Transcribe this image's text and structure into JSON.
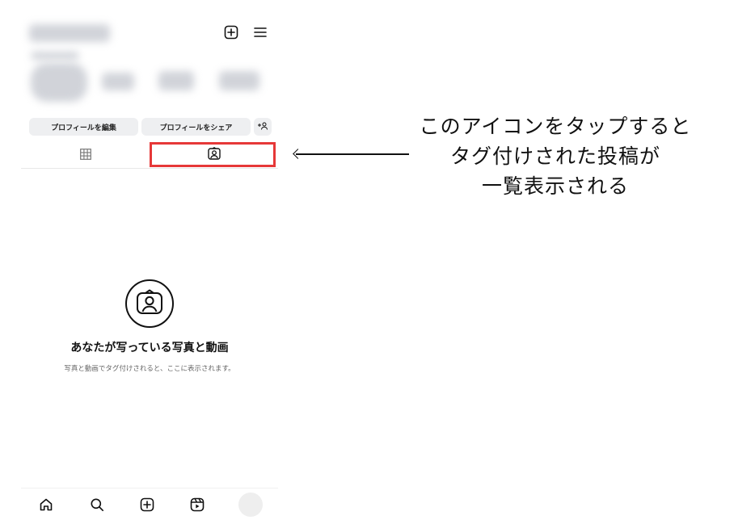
{
  "profile": {
    "edit_button": "プロフィールを編集",
    "share_button": "プロフィールをシェア"
  },
  "header": {
    "new_post_icon": "plus-square-icon",
    "menu_icon": "hamburger-menu-icon"
  },
  "tabs": [
    {
      "icon": "grid-icon",
      "selected": false
    },
    {
      "icon": "tagged-person-icon",
      "selected": true
    }
  ],
  "empty_state": {
    "icon": "tagged-person-icon",
    "title": "あなたが写っている写真と動画",
    "subtitle": "写真と動画でタグ付けされると、ここに表示されます。"
  },
  "bottom_nav": [
    {
      "icon": "home-icon"
    },
    {
      "icon": "search-icon"
    },
    {
      "icon": "create-icon"
    },
    {
      "icon": "reels-icon"
    },
    {
      "icon": "profile-avatar"
    }
  ],
  "annotation": {
    "line1": "このアイコンをタップすると",
    "line2": "タグ付けされた投稿が",
    "line3": "一覧表示される"
  },
  "colors": {
    "highlight": "#e63838",
    "pill_bg": "#eeeff1"
  }
}
